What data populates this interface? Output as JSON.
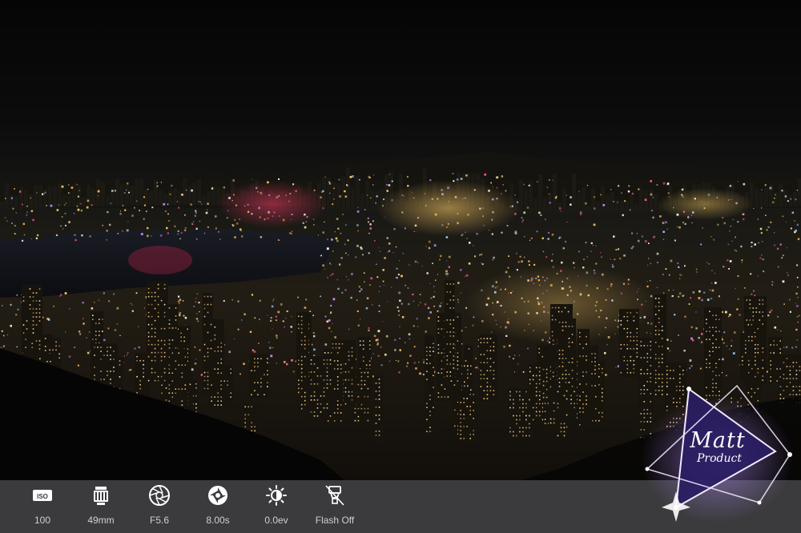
{
  "photo": {
    "subject": "night-city-skyline-photo"
  },
  "exif": [
    {
      "icon": "iso-icon",
      "label": "100"
    },
    {
      "icon": "lens-icon",
      "label": "49mm"
    },
    {
      "icon": "aperture-icon",
      "label": "F5.6"
    },
    {
      "icon": "shutter-icon",
      "label": "8.00s"
    },
    {
      "icon": "exposure-icon",
      "label": "0.0ev"
    },
    {
      "icon": "flash-icon",
      "label": "Flash Off"
    }
  ],
  "exif_icon_texts": {
    "iso": "ISO"
  },
  "watermark": {
    "line1": "Matt",
    "line2": "Product",
    "colors": {
      "triangle_fill": "#2a1d63",
      "triangle_stroke": "#f5e9ff",
      "glow": "#9b6bff"
    }
  },
  "colors": {
    "bar_bg": "#3b3b3d",
    "bar_text": "#cfcfcf"
  }
}
